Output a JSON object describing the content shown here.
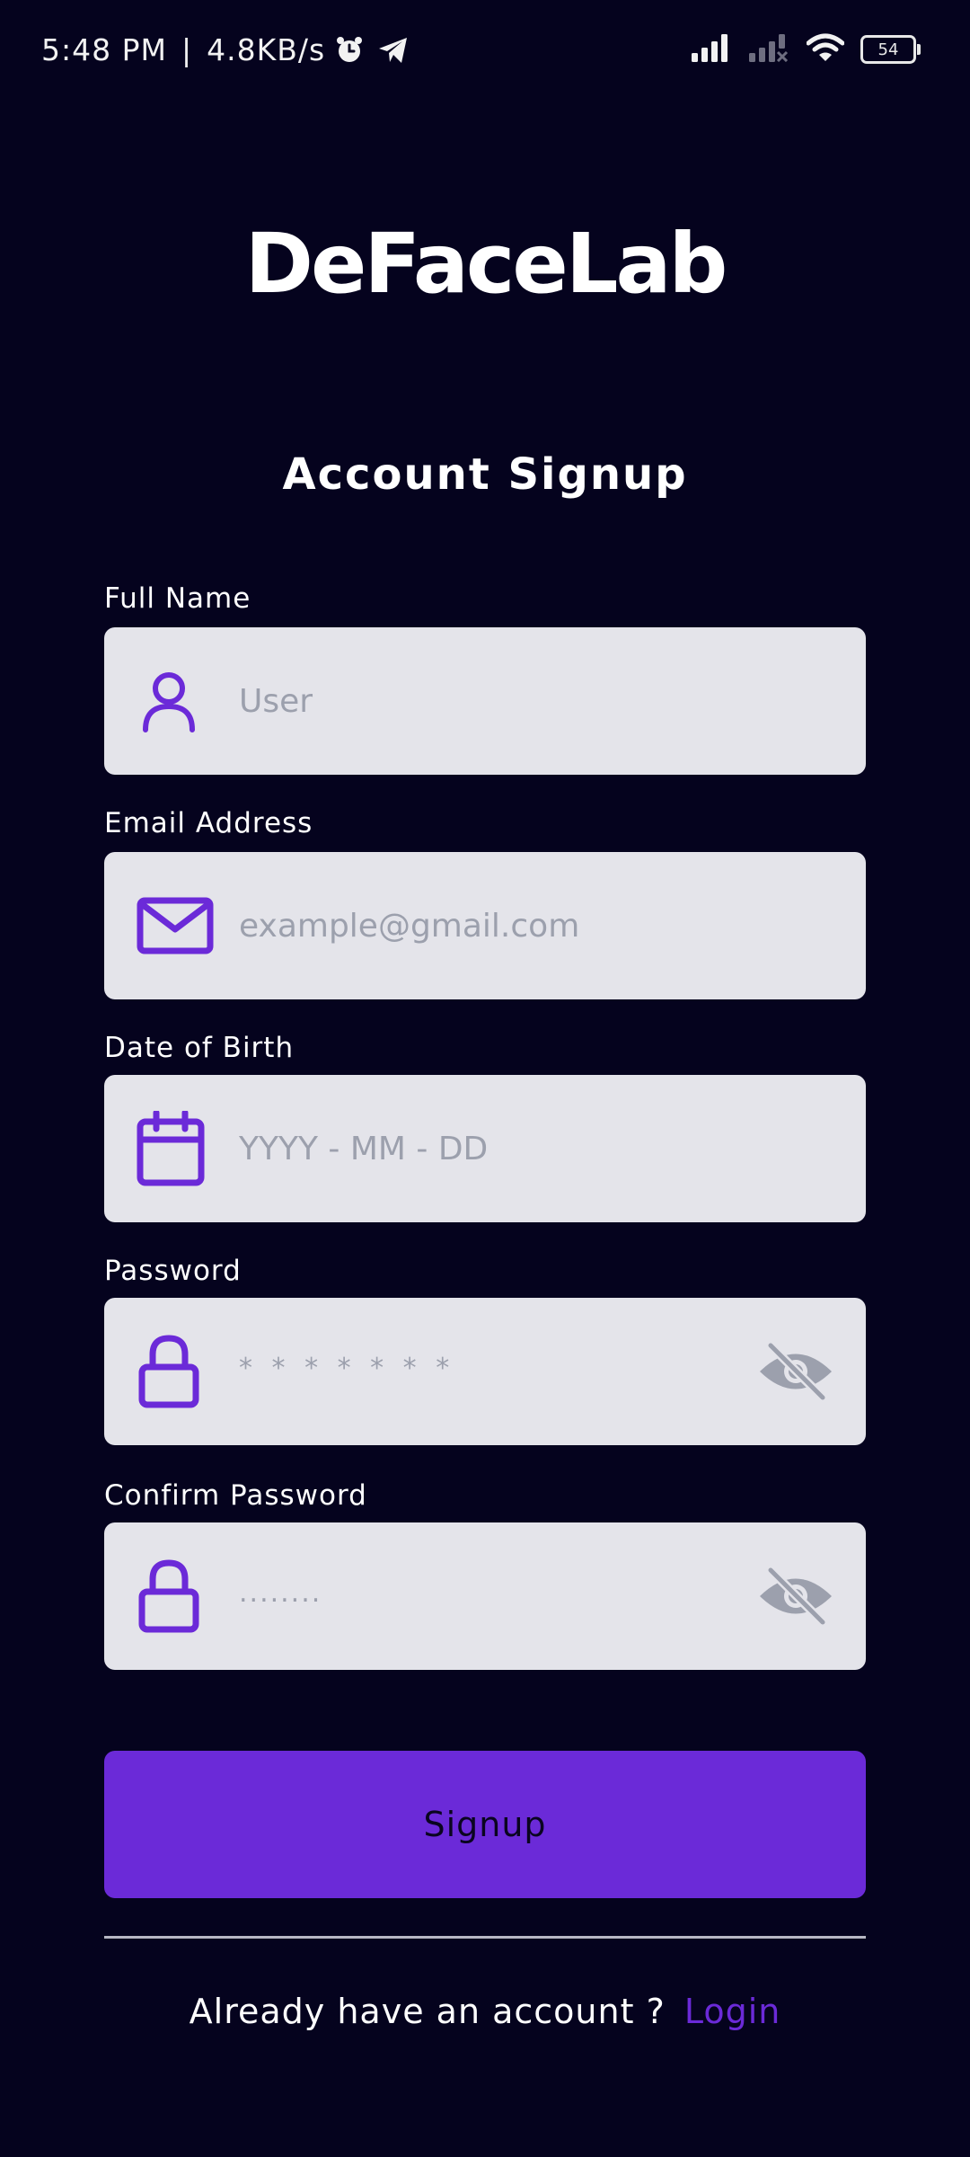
{
  "status_bar": {
    "time": "5:48 PM",
    "separator": "|",
    "network_speed": "4.8KB/s",
    "battery_level": "54",
    "icons": [
      "alarm-icon",
      "telegram-icon",
      "signal-icon",
      "signal-x-icon",
      "wifi-icon",
      "battery-icon"
    ]
  },
  "app": {
    "title": "DeFaceLab"
  },
  "form": {
    "title": "Account Signup",
    "fields": {
      "full_name": {
        "label": "Full Name",
        "placeholder": "User",
        "icon": "user-icon"
      },
      "email": {
        "label": "Email Address",
        "placeholder": "example@gmail.com",
        "icon": "mail-icon"
      },
      "dob": {
        "label": "Date of Birth",
        "placeholder": "YYYY - MM - DD",
        "icon": "calendar-icon"
      },
      "password": {
        "label": "Password",
        "placeholder": "* * * * * * *",
        "icon": "lock-icon",
        "toggle_icon": "eye-off-icon"
      },
      "confirm_password": {
        "label": "Confirm Password",
        "placeholder": "........",
        "icon": "lock-icon",
        "toggle_icon": "eye-off-icon"
      }
    },
    "submit_label": "Signup"
  },
  "footer": {
    "prompt": "Already have an account ?",
    "login_label": "Login"
  },
  "colors": {
    "background": "#05031e",
    "accent": "#6b2ad8",
    "field_bg": "#e4e4ea",
    "placeholder": "#9ca0ad"
  }
}
